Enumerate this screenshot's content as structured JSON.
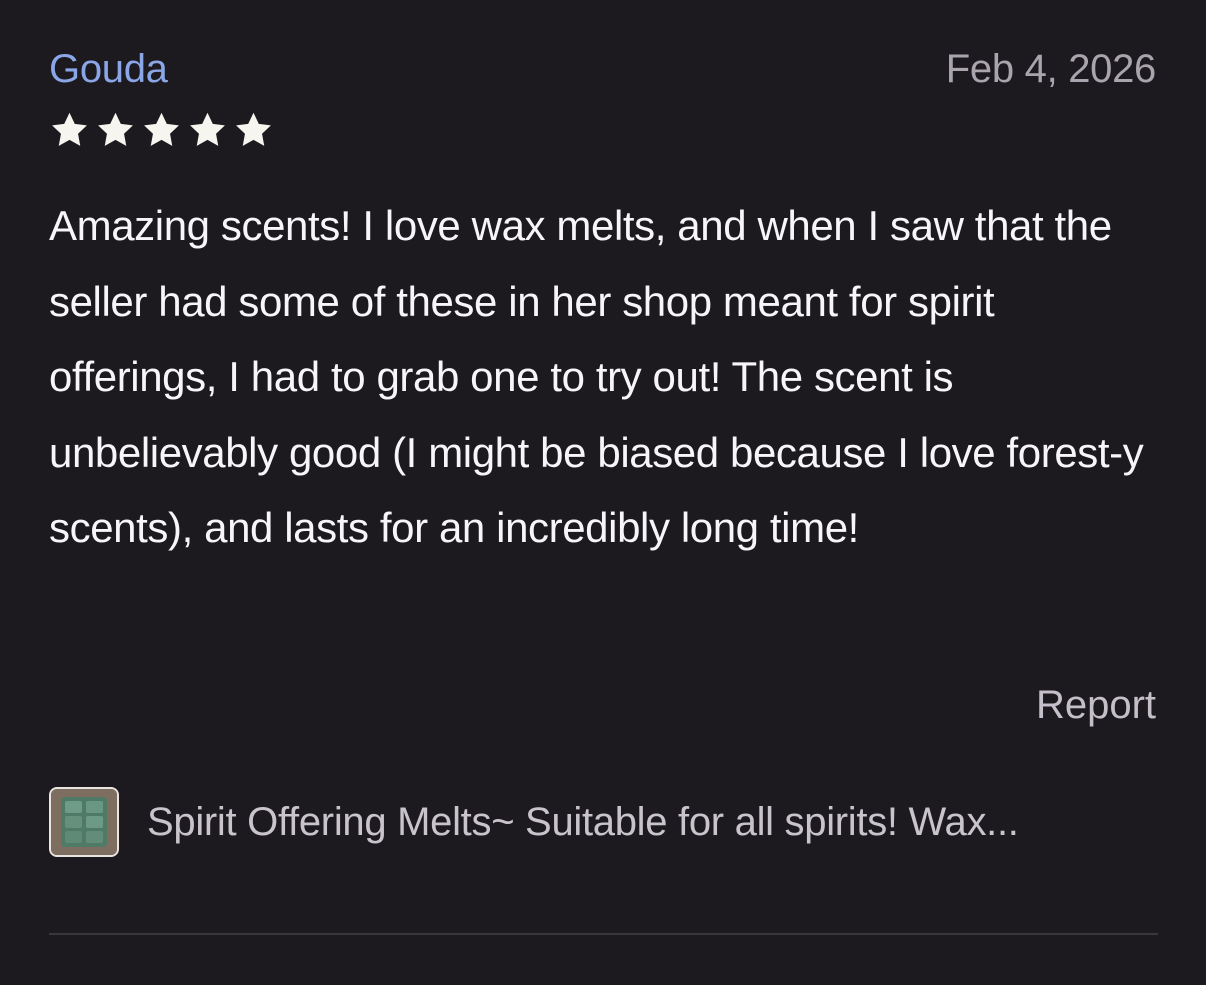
{
  "review": {
    "reviewer_name": "Gouda",
    "date": "Feb 4, 2026",
    "rating": 5,
    "rating_max": 5,
    "body": "Amazing scents! I love wax melts, and when I saw that the seller had some of these in her shop meant for spirit offerings, I had to grab one to try out! The scent is unbelievably good (I might be biased because I love forest-y scents), and lasts for an incredibly long time!",
    "report_label": "Report"
  },
  "listing": {
    "title": "Spirit Offering Melts~ Suitable for all spirits! Wax...",
    "thumbnail_icon": "wax-melt-thumbnail"
  },
  "colors": {
    "background": "#1c1a1e",
    "reviewer_name": "#8aa6e6",
    "star": "#f7f5f0",
    "text": "#f7f5f8",
    "muted": "#a9a4ad"
  }
}
